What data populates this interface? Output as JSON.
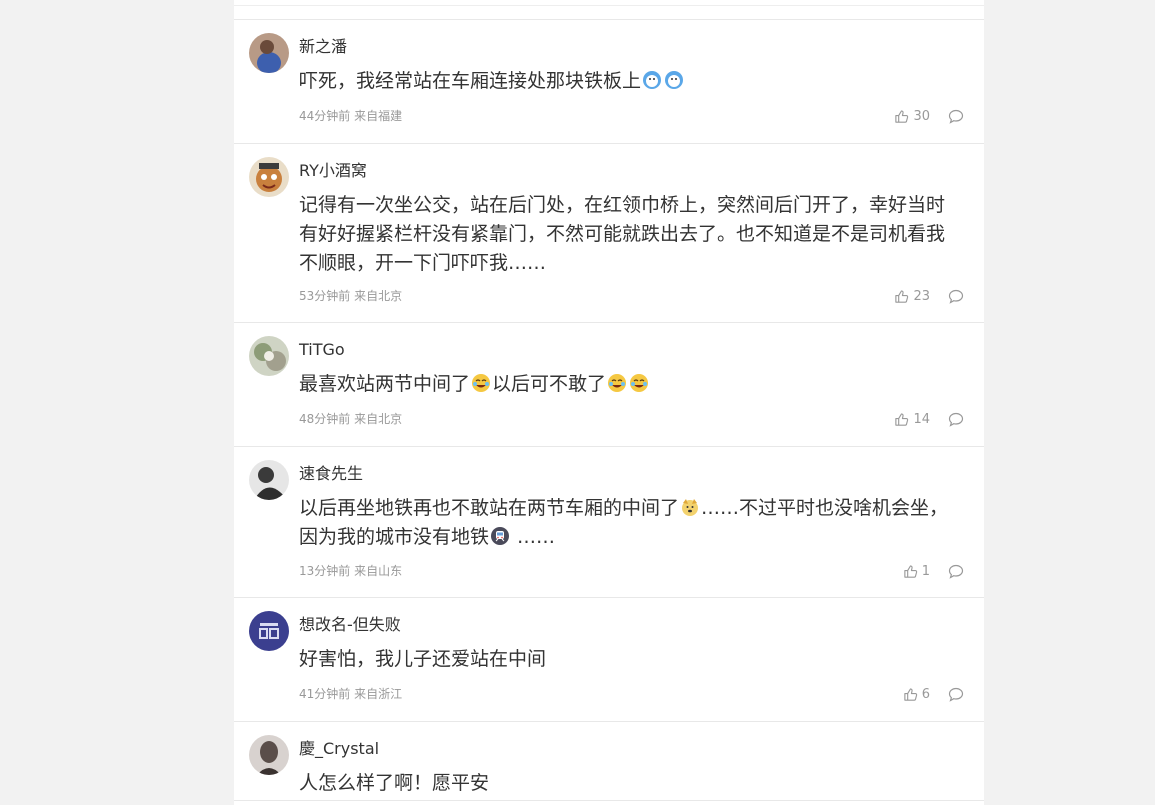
{
  "comments": [
    {
      "username": "新之潘",
      "text_a": "吓死，我经常站在车厢连接处那块铁板上",
      "text_b": "",
      "emoji": [
        "doge-emoji",
        "doge-emoji"
      ],
      "time": "44分钟前",
      "location": "来自福建",
      "likes": "30",
      "avatar_color": "#4a6fb5"
    },
    {
      "username": "RY小酒窝",
      "text_a": "记得有一次坐公交，站在后门处，在红领巾桥上，突然间后门开了，幸好当时有好好握紧栏杆没有紧靠门，不然可能就跌出去了。也不知道是不是司机看我不顺眼，开一下门吓吓我……",
      "text_b": "",
      "time": "53分钟前",
      "location": "来自北京",
      "likes": "23",
      "avatar_color": "#c97a3a"
    },
    {
      "username": "TiTGo",
      "text_a": "最喜欢站两节中间了",
      "text_b": "以后可不敢了",
      "time": "48分钟前",
      "location": "来自北京",
      "likes": "14",
      "avatar_color": "#8a9a7a"
    },
    {
      "username": "速食先生",
      "text_a": "以后再坐地铁再也不敢站在两节车厢的中间了",
      "text_b": "……不过平时也没啥机会坐，因为我的城市没有地铁",
      "text_c": " ……",
      "time": "13分钟前",
      "location": "来自山东",
      "likes": "1",
      "avatar_color": "#5a5a5a"
    },
    {
      "username": "想改名-但失败",
      "text_a": "好害怕，我儿子还爱站在中间",
      "text_b": "",
      "time": "41分钟前",
      "location": "来自浙江",
      "likes": "6",
      "avatar_color": "#3b3f8f"
    },
    {
      "username": "慶_Crystal",
      "text_a": "人怎么样了啊！愿平安",
      "text_b": "",
      "avatar_color": "#7a6a66"
    }
  ],
  "colors": {
    "text": "#333333",
    "meta": "#999999",
    "divider": "#e8e8e8",
    "page_bg": "#f2f2f2"
  }
}
